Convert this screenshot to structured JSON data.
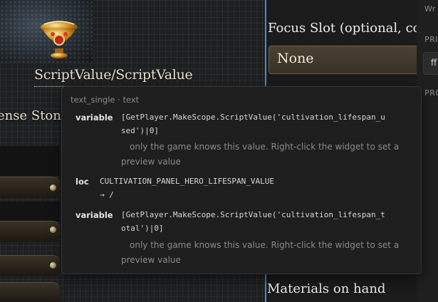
{
  "canvas": {
    "hero_title": "ScriptValue/ScriptValue",
    "stone_label": "ense Ston",
    "focus_label": "Focus Slot (optional, cor",
    "focus_value": "None",
    "materials_label": "Materials on hand"
  },
  "panel": {
    "top_label": "Wr",
    "section_1": "PRI",
    "input_value": "ff",
    "section_2": "PRO"
  },
  "tooltip": {
    "header": "text_single · text",
    "rows": [
      {
        "key": "variable",
        "code_line1": "[GetPlayer.MakeScope.ScriptValue('cultivation_lifespan_u",
        "code_line2": "sed')|0]",
        "note_line1": "only the game knows this value. Right-click the widget to set a",
        "note_line2": "preview value"
      },
      {
        "key": "loc",
        "code_line1": "CULTIVATION_PANEL_HERO_LIFESPAN_VALUE",
        "code_line2": "→ /"
      },
      {
        "key": "variable",
        "code_line1": "[GetPlayer.MakeScope.ScriptValue('cultivation_lifespan_t",
        "code_line2": "otal')|0]",
        "note_line1": "only the game knows this value. Right-click the widget to set a",
        "note_line2": "preview value"
      }
    ]
  },
  "colors": {
    "selection_line": "#3f8ed6",
    "tooltip_bg": "#1e1e1e",
    "gold_text": "#e9e1cf"
  }
}
